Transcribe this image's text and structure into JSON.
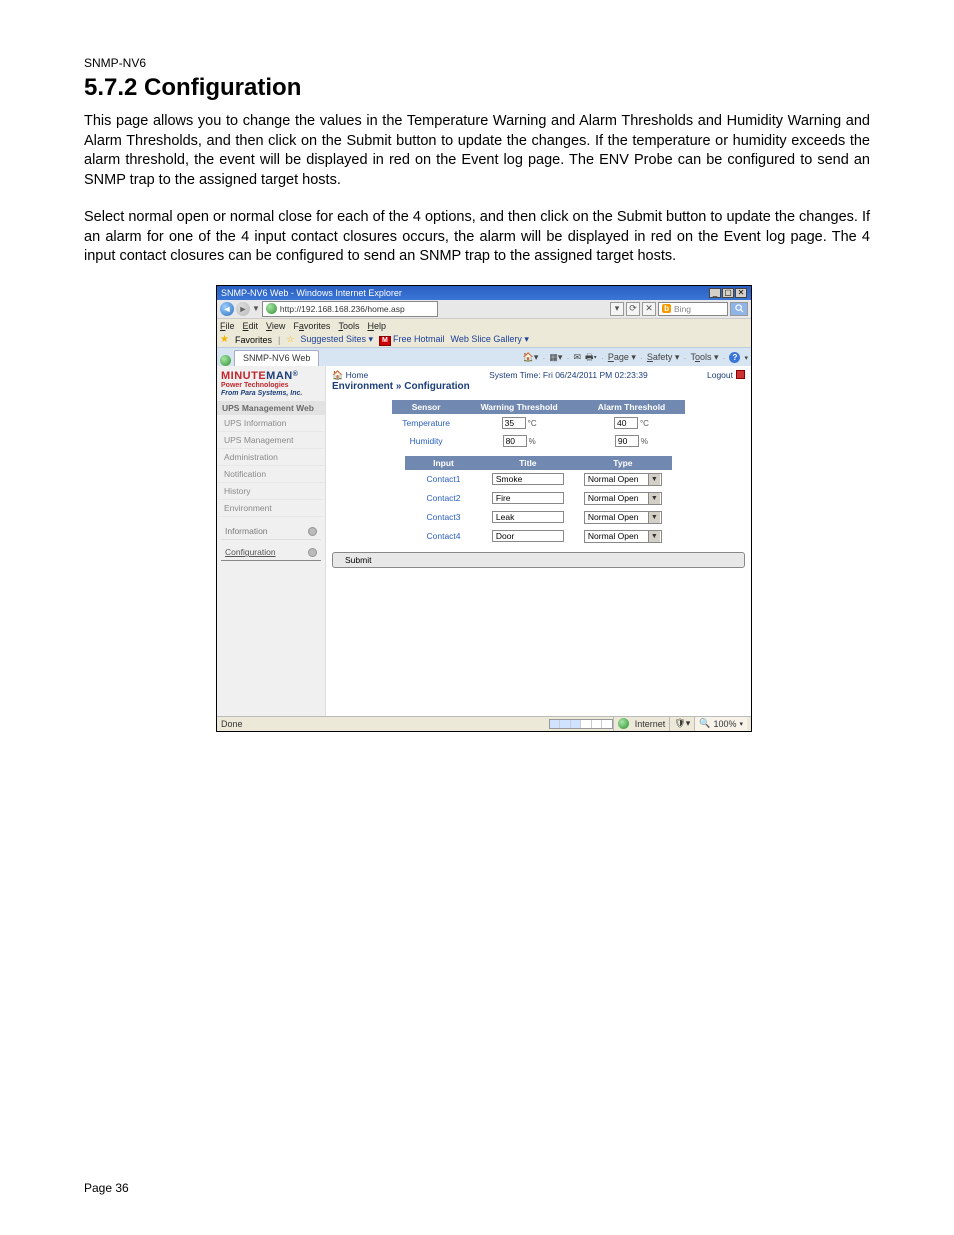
{
  "doc": {
    "header": "SNMP-NV6",
    "title": "5.7.2 Configuration",
    "para1": "This page allows you to change the values in the Temperature Warning and Alarm Thresholds and Humidity Warning and Alarm Thresholds, and then click on the Submit button to update the changes.  If the temperature or humidity exceeds the alarm threshold, the event will be displayed in red on the Event log page.  The ENV Probe can be configured to send an SNMP trap to the assigned target hosts.",
    "para2": "Select normal open or normal close for each of the 4 options, and then click on the Submit button to update the changes.  If an alarm for one of the 4 input contact closures occurs, the alarm will be displayed in red on the Event log page.  The 4 input contact closures can be configured to send an SNMP trap to the assigned target hosts.",
    "footer": "Page 36"
  },
  "ie": {
    "title": "SNMP-NV6 Web - Windows Internet Explorer",
    "url": "http://192.168.168.236/home.asp",
    "search_placeholder": "Bing",
    "menu": {
      "file": "File",
      "edit": "Edit",
      "view": "View",
      "favorites": "Favorites",
      "tools": "Tools",
      "help": "Help"
    },
    "favbar": {
      "label": "Favorites",
      "suggested": "Suggested Sites ▾",
      "hotmail": "Free Hotmail",
      "webslice": "Web Slice Gallery ▾"
    },
    "tab": "SNMP-NV6 Web",
    "tools": {
      "page": "Page ▾",
      "safety": "Safety ▾",
      "toolsmenu": "Tools ▾"
    },
    "status": {
      "done": "Done",
      "zone": "Internet",
      "protected": "",
      "zoom": "100%"
    }
  },
  "app": {
    "logo": {
      "line1a": "MINUTE",
      "line1b": "MAN",
      "reg": "®",
      "line2": "Power Technologies",
      "line3": "From Para Systems, Inc."
    },
    "nav": {
      "head": "UPS Management Web",
      "items": [
        "UPS Information",
        "UPS Management",
        "Administration",
        "Notification",
        "History",
        "Environment"
      ]
    },
    "subnav": {
      "information": "Information",
      "configuration": "Configuration"
    },
    "crumb_home": "Home",
    "crumb_title": "Environment » Configuration",
    "system_time": "System Time: Fri 06/24/2011 PM 02:23:39",
    "logout": "Logout",
    "table1": {
      "h_sensor": "Sensor",
      "h_warn": "Warning Threshold",
      "h_alarm": "Alarm Threshold",
      "r1_label": "Temperature",
      "r1_warn": "35",
      "r1_warn_unit": "°C",
      "r1_alarm": "40",
      "r1_alarm_unit": "°C",
      "r2_label": "Humidity",
      "r2_warn": "80",
      "r2_warn_unit": "%",
      "r2_alarm": "90",
      "r2_alarm_unit": "%"
    },
    "table2": {
      "h_input": "Input",
      "h_title": "Title",
      "h_type": "Type",
      "rows": [
        {
          "input": "Contact1",
          "title": "Smoke",
          "type": "Normal Open"
        },
        {
          "input": "Contact2",
          "title": "Fire",
          "type": "Normal Open"
        },
        {
          "input": "Contact3",
          "title": "Leak",
          "type": "Normal Open"
        },
        {
          "input": "Contact4",
          "title": "Door",
          "type": "Normal Open"
        }
      ]
    },
    "submit": "Submit"
  }
}
